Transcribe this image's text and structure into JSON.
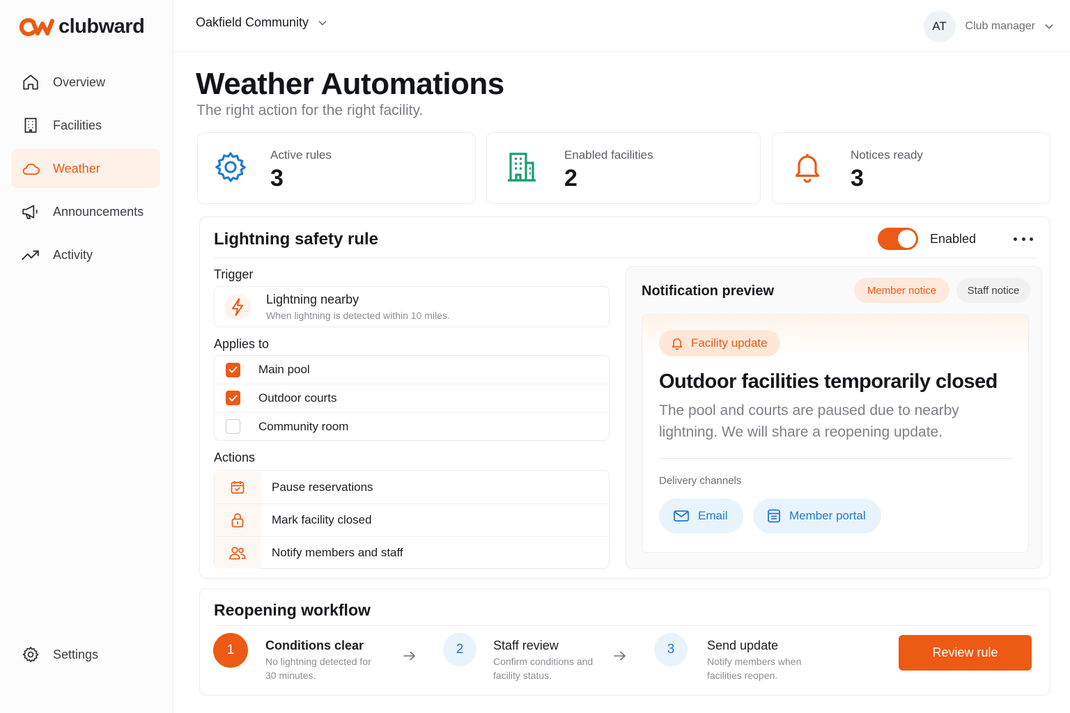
{
  "brand": {
    "name": "clubward",
    "accent": "#ec5a14",
    "blue": "#1f7ad1",
    "green": "#1a9e6e"
  },
  "sidebar": {
    "items": [
      {
        "label": "Overview",
        "icon": "home-icon",
        "active": false
      },
      {
        "label": "Facilities",
        "icon": "building-icon",
        "active": false
      },
      {
        "label": "Weather",
        "icon": "cloud-icon",
        "active": true
      },
      {
        "label": "Announcements",
        "icon": "megaphone-icon",
        "active": false
      },
      {
        "label": "Activity",
        "icon": "trend-icon",
        "active": false
      }
    ],
    "settings_label": "Settings"
  },
  "topbar": {
    "community": "Oakfield Community",
    "user_initials": "AT",
    "user_role": "Club manager"
  },
  "header": {
    "title": "Weather Automations",
    "subtitle": "The right action for the right facility."
  },
  "stats": [
    {
      "label": "Active rules",
      "value": "3",
      "icon": "gear-icon"
    },
    {
      "label": "Enabled facilities",
      "value": "2",
      "icon": "building-icon"
    },
    {
      "label": "Notices ready",
      "value": "3",
      "icon": "bell-icon"
    }
  ],
  "rule": {
    "title": "Lightning safety rule",
    "enabled": true,
    "enabled_label": "Enabled",
    "trigger_label": "Trigger",
    "trigger": {
      "name": "Lightning nearby",
      "description": "When lightning is detected within 10 miles."
    },
    "applies_label": "Applies to",
    "applies": [
      {
        "label": "Main pool",
        "checked": true
      },
      {
        "label": "Outdoor courts",
        "checked": true
      },
      {
        "label": "Community room",
        "checked": false
      }
    ],
    "actions_label": "Actions",
    "actions": [
      {
        "label": "Pause reservations",
        "icon": "calendar-icon"
      },
      {
        "label": "Mark facility closed",
        "icon": "lock-icon"
      },
      {
        "label": "Notify members and staff",
        "icon": "users-icon"
      }
    ]
  },
  "preview": {
    "title": "Notification preview",
    "tabs": [
      "Member notice",
      "Staff notice"
    ],
    "selected_tab": "Member notice",
    "badge": "Facility update",
    "notice_title": "Outdoor facilities temporarily closed",
    "notice_body": "The pool and courts are paused due to nearby lightning. We will share a reopening update.",
    "channels_label": "Delivery channels",
    "channels": [
      "Email",
      "Member portal"
    ]
  },
  "workflow": {
    "title": "Reopening workflow",
    "steps": [
      {
        "num": "1",
        "title": "Conditions clear",
        "desc": "No lightning detected for 30 minutes."
      },
      {
        "num": "2",
        "title": "Staff review",
        "desc": "Confirm conditions and facility status."
      },
      {
        "num": "3",
        "title": "Send update",
        "desc": "Notify members when facilities reopen."
      }
    ],
    "button": "Review rule"
  }
}
